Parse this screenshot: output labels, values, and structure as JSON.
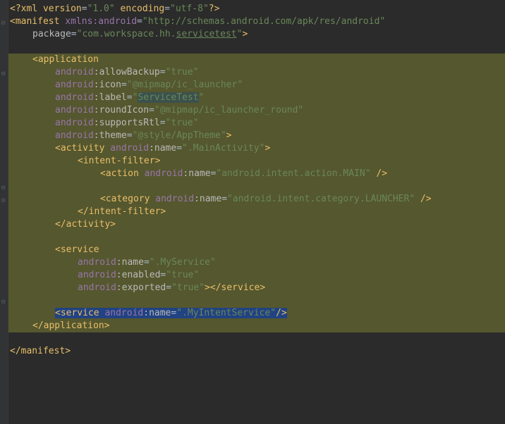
{
  "xml_decl": {
    "version": "1.0",
    "encoding": "utf-8"
  },
  "manifest": {
    "xmlns_attr": "xmlns:android",
    "xmlns_val": "http://schemas.android.com/apk/res/android",
    "package_attr": "package",
    "package_val_prefix": "com.workspace.hh.",
    "package_val_suffix": "servicetest"
  },
  "application": {
    "tag": "application",
    "attrs": {
      "allowBackup": {
        "ns": "android",
        "name": "allowBackup",
        "val": "true"
      },
      "icon": {
        "ns": "android",
        "name": "icon",
        "val": "@mipmap/ic_launcher"
      },
      "label": {
        "ns": "android",
        "name": "label",
        "val": "ServiceTest"
      },
      "roundIcon": {
        "ns": "android",
        "name": "roundIcon",
        "val": "@mipmap/ic_launcher_round"
      },
      "supportsRtl": {
        "ns": "android",
        "name": "supportsRtl",
        "val": "true"
      },
      "theme": {
        "ns": "android",
        "name": "theme",
        "val": "@style/AppTheme"
      }
    }
  },
  "activity": {
    "tag": "activity",
    "name_ns": "android",
    "name_attr": "name",
    "name_val": ".MainActivity"
  },
  "intent_filter": {
    "tag": "intent-filter"
  },
  "action": {
    "tag": "action",
    "name_ns": "android",
    "name_attr": "name",
    "name_val": "android.intent.action.MAIN"
  },
  "category": {
    "tag": "category",
    "name_ns": "android",
    "name_attr": "name",
    "name_val": "android.intent.category.LAUNCHER"
  },
  "service1": {
    "tag": "service",
    "name": {
      "ns": "android",
      "attr": "name",
      "val": ".MyService"
    },
    "enabled": {
      "ns": "android",
      "attr": "enabled",
      "val": "true"
    },
    "exported": {
      "ns": "android",
      "attr": "exported",
      "val": "true"
    }
  },
  "service2": {
    "tag": "service",
    "name_ns": "android",
    "name_attr": "name",
    "name_val": ".MyIntentService"
  },
  "close": {
    "intent_filter": "intent-filter",
    "activity": "activity",
    "service": "service",
    "application": "application",
    "manifest": "manifest"
  }
}
